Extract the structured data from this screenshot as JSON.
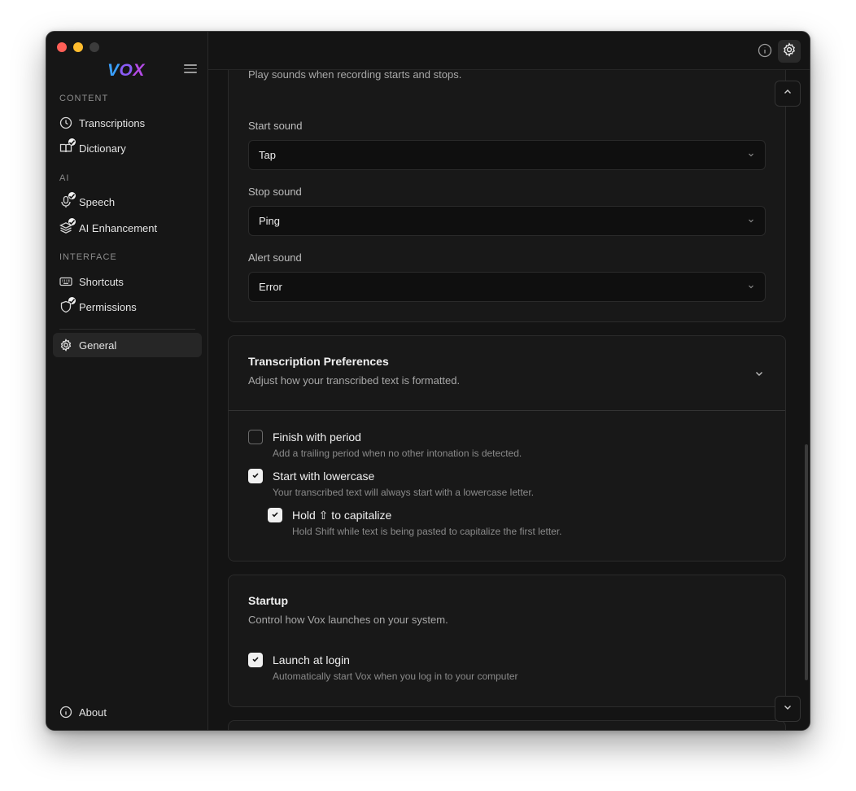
{
  "app": {
    "logo": [
      "V",
      "O",
      "X"
    ]
  },
  "sidebar": {
    "sections": [
      {
        "title": "CONTENT"
      },
      {
        "title": "AI"
      },
      {
        "title": "INTERFACE"
      }
    ],
    "items": [
      {
        "label": "Transcriptions",
        "icon": "clock-icon"
      },
      {
        "label": "Dictionary",
        "icon": "book-icon"
      },
      {
        "label": "Speech",
        "icon": "microphone-icon"
      },
      {
        "label": "AI Enhancement",
        "icon": "layers-icon"
      },
      {
        "label": "Shortcuts",
        "icon": "keyboard-icon"
      },
      {
        "label": "Permissions",
        "icon": "shield-icon"
      },
      {
        "label": "General",
        "icon": "gear-icon"
      }
    ],
    "about": {
      "label": "About",
      "icon": "info-icon"
    }
  },
  "sound": {
    "description": "Play sounds when recording starts and stops.",
    "start": {
      "label": "Start sound",
      "value": "Tap"
    },
    "stop": {
      "label": "Stop sound",
      "value": "Ping"
    },
    "alert": {
      "label": "Alert sound",
      "value": "Error"
    }
  },
  "transcription": {
    "title": "Transcription Preferences",
    "description": "Adjust how your transcribed text is formatted.",
    "options": [
      {
        "label": "Finish with period",
        "sub": "Add a trailing period when no other intonation is detected.",
        "checked": false
      },
      {
        "label": "Start with lowercase",
        "sub": "Your transcribed text will always start with a lowercase letter.",
        "checked": true
      },
      {
        "label": "Hold ⇧ to capitalize",
        "sub": "Hold Shift while text is being pasted to capitalize the first letter.",
        "checked": true
      }
    ]
  },
  "startup": {
    "title": "Startup",
    "description": "Control how Vox launches on your system.",
    "options": [
      {
        "label": "Launch at login",
        "sub": "Automatically start Vox when you log in to your computer",
        "checked": true
      }
    ]
  },
  "colors": {
    "background": "#141414",
    "sidebar": "#161616",
    "card": "#181818",
    "checkbox_on": "#f0f0f0"
  }
}
